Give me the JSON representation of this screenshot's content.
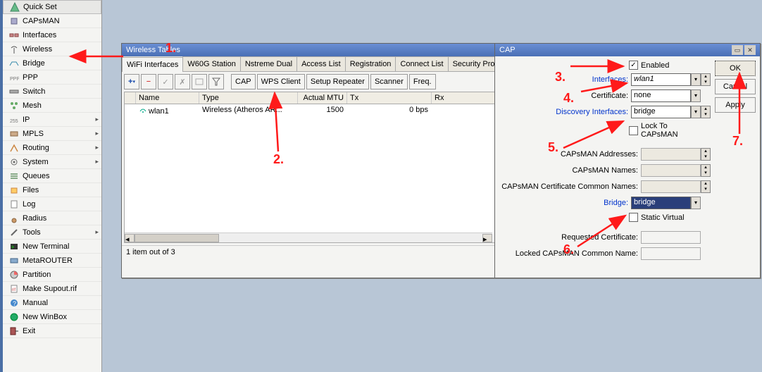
{
  "sidebar": {
    "items": [
      {
        "label": "Quick Set"
      },
      {
        "label": "CAPsMAN"
      },
      {
        "label": "Interfaces"
      },
      {
        "label": "Wireless"
      },
      {
        "label": "Bridge"
      },
      {
        "label": "PPP"
      },
      {
        "label": "Switch"
      },
      {
        "label": "Mesh"
      },
      {
        "label": "IP",
        "submenu": true
      },
      {
        "label": "MPLS",
        "submenu": true
      },
      {
        "label": "Routing",
        "submenu": true
      },
      {
        "label": "System",
        "submenu": true
      },
      {
        "label": "Queues"
      },
      {
        "label": "Files"
      },
      {
        "label": "Log"
      },
      {
        "label": "Radius"
      },
      {
        "label": "Tools",
        "submenu": true
      },
      {
        "label": "New Terminal"
      },
      {
        "label": "MetaROUTER"
      },
      {
        "label": "Partition"
      },
      {
        "label": "Make Supout.rif"
      },
      {
        "label": "Manual"
      },
      {
        "label": "New WinBox"
      },
      {
        "label": "Exit"
      }
    ]
  },
  "wt": {
    "title": "Wireless Tables",
    "tabs": [
      "WiFi Interfaces",
      "W60G Station",
      "Nstreme Dual",
      "Access List",
      "Registration",
      "Connect List",
      "Security Profiles"
    ],
    "toolbar": {
      "cap": "CAP",
      "wps": "WPS Client",
      "setup": "Setup Repeater",
      "scanner": "Scanner",
      "freq": "Freq."
    },
    "columns": [
      "Name",
      "Type",
      "Actual MTU",
      "Tx",
      "Rx"
    ],
    "rows": [
      {
        "name": "wlan1",
        "type": "Wireless (Atheros AR...",
        "mtu": "1500",
        "tx": "0 bps",
        "rx": ""
      }
    ],
    "status": "1 item out of 3"
  },
  "cap": {
    "title": "CAP",
    "ok": "OK",
    "cancel": "Cancel",
    "apply": "Apply",
    "enabled_label": "Enabled",
    "interfaces_label": "Interfaces:",
    "interfaces_value": "wlan1",
    "certificate_label": "Certificate:",
    "certificate_value": "none",
    "discovery_label": "Discovery Interfaces:",
    "discovery_value": "bridge",
    "lock_label": "Lock To CAPsMAN",
    "addresses_label": "CAPsMAN Addresses:",
    "names_label": "CAPsMAN Names:",
    "ccn_label": "CAPsMAN Certificate Common Names:",
    "bridge_label": "Bridge:",
    "bridge_value": "bridge",
    "static_label": "Static Virtual",
    "reqcert_label": "Requested Certificate:",
    "locked_cn_label": "Locked CAPsMAN Common Name:"
  },
  "anno": {
    "n1": "1.",
    "n2": "2.",
    "n3": "3.",
    "n4": "4.",
    "n5": "5.",
    "n6": "6.",
    "n7": "7."
  }
}
